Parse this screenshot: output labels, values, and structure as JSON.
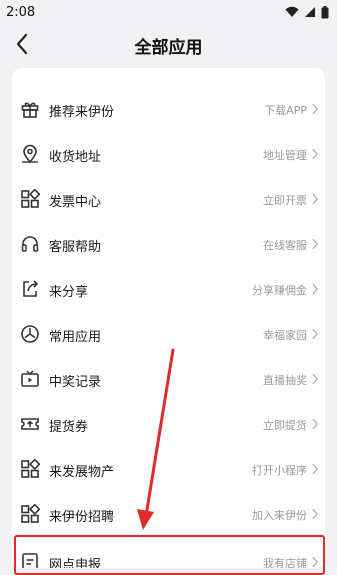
{
  "status": {
    "time": "2:08"
  },
  "header": {
    "title": "全部应用"
  },
  "partial_item": {
    "label": "",
    "icon": "ticket-icon"
  },
  "items": [
    {
      "label": "推荐来伊份",
      "action": "下载APP",
      "icon": "gift-icon"
    },
    {
      "label": "收货地址",
      "action": "地址管理",
      "icon": "location-pin-icon"
    },
    {
      "label": "发票中心",
      "action": "立即开票",
      "icon": "grid-icon"
    },
    {
      "label": "客服帮助",
      "action": "在线客服",
      "icon": "headphones-icon"
    },
    {
      "label": "来分享",
      "action": "分享赚佣金",
      "icon": "share-icon"
    },
    {
      "label": "常用应用",
      "action": "幸福家园",
      "icon": "compass-icon"
    },
    {
      "label": "中奖记录",
      "action": "直播抽奖",
      "icon": "tv-icon"
    },
    {
      "label": "提货券",
      "action": "立即提货",
      "icon": "voucher-icon"
    },
    {
      "label": "来发展物产",
      "action": "打开小程序",
      "icon": "grid-icon"
    },
    {
      "label": "来伊份招聘",
      "action": "加入来伊份",
      "icon": "grid-icon"
    },
    {
      "label": "网点申报",
      "action": "我有店铺",
      "icon": "document-icon"
    }
  ],
  "colors": {
    "highlight": "#e32a2a",
    "action_text": "#9a9a9a"
  }
}
